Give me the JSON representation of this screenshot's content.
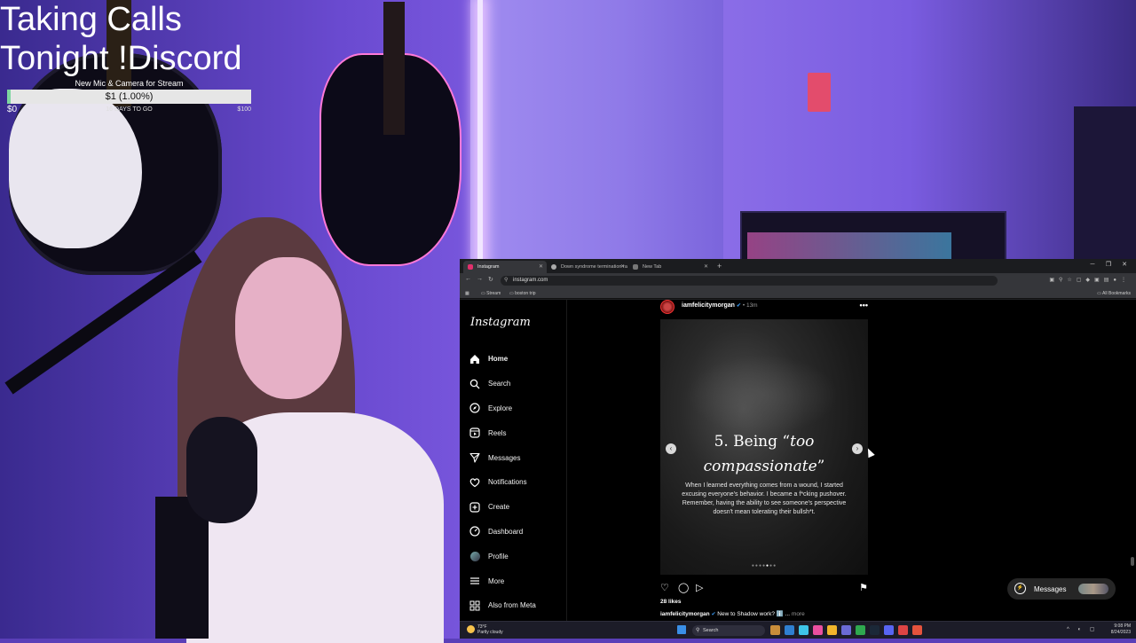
{
  "overlay": {
    "title_line1": "Taking Calls",
    "title_line2": "Tonight !Discord",
    "goal_caption": "New Mic & Camera for Stream",
    "goal_amount": "$1 (1.00%)",
    "goal_progress": 0.01,
    "goal_min": "$0",
    "goal_days": "16 DAYS TO GO",
    "goal_max": "$100"
  },
  "browser": {
    "tabs": [
      {
        "label": "Instagram",
        "active": true
      },
      {
        "label": "Down syndrome termination ra",
        "active": false
      },
      {
        "label": "New Tab",
        "active": false
      }
    ],
    "url": "instagram.com",
    "bookmarks": [
      "Stream",
      "boston trip"
    ],
    "all_bookmarks": "All Bookmarks",
    "nav_icons": [
      "back-icon",
      "forward-icon",
      "reload-icon"
    ]
  },
  "instagram": {
    "logo": "Instagram",
    "nav": [
      {
        "label": "Home",
        "icon": "home-icon"
      },
      {
        "label": "Search",
        "icon": "search-icon"
      },
      {
        "label": "Explore",
        "icon": "compass-icon"
      },
      {
        "label": "Reels",
        "icon": "reels-icon"
      },
      {
        "label": "Messages",
        "icon": "send-icon"
      },
      {
        "label": "Notifications",
        "icon": "heart-icon"
      },
      {
        "label": "Create",
        "icon": "plus-icon"
      },
      {
        "label": "Dashboard",
        "icon": "dashboard-icon"
      },
      {
        "label": "Profile",
        "icon": "avatar"
      },
      {
        "label": "More",
        "icon": "menu-icon"
      },
      {
        "label": "Also from Meta",
        "icon": "meta-icon"
      }
    ],
    "post": {
      "username": "iamfelicitymorgan",
      "time": "13m",
      "heading_prefix": "5. Being “",
      "heading_italic": "too compassionate",
      "heading_suffix": "”",
      "body": "When I learned everything comes from a wound, I started excusing everyone's behavior. I became a f*cking pushover. Remember, having the ability to see  someone's perspective doesn't mean tolerating their bullsh*t.",
      "likes": "28 likes",
      "caption_user": "iamfelicitymorgan",
      "caption_text": "New to Shadow work? ℹ️ ...",
      "caption_more": "more",
      "slide_count": 7,
      "current_slide": 5
    },
    "messages_label": "Messages"
  },
  "taskbar": {
    "temp": "73°F",
    "weather": "Partly cloudy",
    "search_placeholder": "Search",
    "time": "9:08 PM",
    "date": "8/24/2023"
  },
  "colors": {
    "goal_fill": "#7ed6a0",
    "verified": "#3897f0",
    "instagram_bg": "#000000",
    "scene_purple": "#7c5ae0"
  }
}
